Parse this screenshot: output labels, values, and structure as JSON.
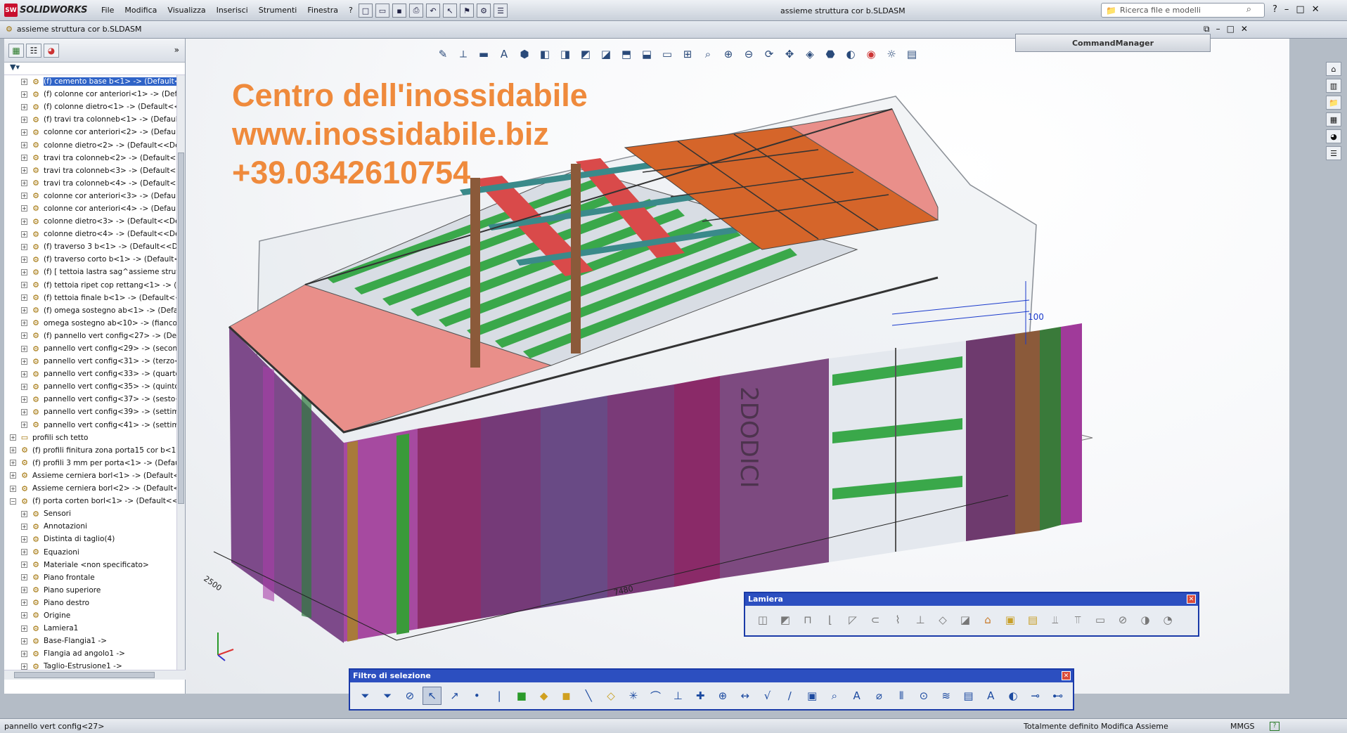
{
  "app": {
    "name": "SOLIDWORKS",
    "badge": "SW"
  },
  "menu": [
    "File",
    "Modifica",
    "Visualizza",
    "Inserisci",
    "Strumenti",
    "Finestra",
    "?"
  ],
  "window_title": "assieme struttura cor b.SLDASM",
  "search_placeholder": "Ricerca file e modelli",
  "doc_tab_title": "assieme struttura cor b.SLDASM",
  "tree": [
    {
      "label": "(f) cemento base b<1> -> (Default<",
      "selected": true
    },
    {
      "label": "(f) colonne cor  anteriori<1> -> (Def"
    },
    {
      "label": "(f) colonne dietro<1> -> (Default<<"
    },
    {
      "label": "(f) travi tra colonneb<1> -> (Default"
    },
    {
      "label": "colonne cor  anteriori<2> -> (Default"
    },
    {
      "label": "colonne dietro<2> -> (Default<<Def"
    },
    {
      "label": "travi tra colonneb<2> -> (Default<<"
    },
    {
      "label": "travi tra colonneb<3> -> (Default<<"
    },
    {
      "label": "travi tra colonneb<4> -> (Default<<"
    },
    {
      "label": "colonne cor  anteriori<3> -> (Default"
    },
    {
      "label": "colonne cor  anteriori<4> -> (Default"
    },
    {
      "label": "colonne dietro<3> -> (Default<<Def"
    },
    {
      "label": "colonne dietro<4> -> (Default<<Def"
    },
    {
      "label": "(f) traverso 3 b<1> -> (Default<<De"
    },
    {
      "label": "(f) traverso corto b<1> -> (Default<"
    },
    {
      "label": "(f) [ tettoia lastra sag^assieme strut"
    },
    {
      "label": "(f) tettoia ripet cop rettang<1> -> (I"
    },
    {
      "label": "(f) tettoia finale b<1> -> (Default<<"
    },
    {
      "label": "(f) omega sostegno ab<1> -> (Defau"
    },
    {
      "label": "omega sostegno ab<10> -> (fianco<"
    },
    {
      "label": "(f) pannello vert config<27> -> (Def"
    },
    {
      "label": "pannello vert config<29> -> (second"
    },
    {
      "label": "pannello vert config<31> -> (terzo<"
    },
    {
      "label": "pannello vert config<33> -> (quarto"
    },
    {
      "label": "pannello vert config<35> -> (quinto"
    },
    {
      "label": "pannello vert config<37> -> (sesto<"
    },
    {
      "label": "pannello vert config<39> -> (settim"
    },
    {
      "label": "pannello vert config<41> -> (settim"
    },
    {
      "label": "profili sch tetto",
      "folder": true
    },
    {
      "label": "(f) profili finitura zona porta15 cor b<1>"
    },
    {
      "label": "(f) profili 3 mm per porta<1> -> (Default"
    },
    {
      "label": "Assieme cerniera borl<1> -> (Default<Stat"
    },
    {
      "label": "Assieme cerniera borl<2> -> (Default<Stat"
    },
    {
      "label": "(f) porta corten borl<1> -> (Default<<D",
      "expanded": true
    },
    {
      "label": "Sensori"
    },
    {
      "label": "Annotazioni"
    },
    {
      "label": "Distinta di taglio(4)"
    },
    {
      "label": "Equazioni"
    },
    {
      "label": "Materiale <non specificato>"
    },
    {
      "label": "Piano frontale"
    },
    {
      "label": "Piano superiore"
    },
    {
      "label": "Piano destro"
    },
    {
      "label": "Origine"
    },
    {
      "label": "Lamiera1"
    },
    {
      "label": "Base-Flangia1 ->"
    },
    {
      "label": "Flangia ad angolo1 ->"
    },
    {
      "label": "Taglio-Estrusione1 ->"
    }
  ],
  "watermark": {
    "line1": "Centro dell'inossidabile",
    "line2": "www.inossidabile.biz",
    "line3": "+39.0342610754"
  },
  "command_manager": "CommandManager",
  "lamiera_title": "Lamiera",
  "filtro_title": "Filtro di selezione",
  "model_text": {
    "door_text": "2DODICI",
    "dim_length": "7480",
    "dim_side": "2500",
    "dim_vert": "100"
  },
  "status": {
    "left": "pannello vert config<27>",
    "s1": "Totalmente definito",
    "s2": "Modifica Assieme",
    "s3": "MMGS"
  },
  "colors": {
    "accent_blue": "#2c4fc0",
    "watermark": "#ef8a3c",
    "roof_green": "#3aa84a",
    "roof_orange": "#d5652a",
    "roof_pink": "#e98f8a",
    "panel_purple": "#7a3a78"
  }
}
